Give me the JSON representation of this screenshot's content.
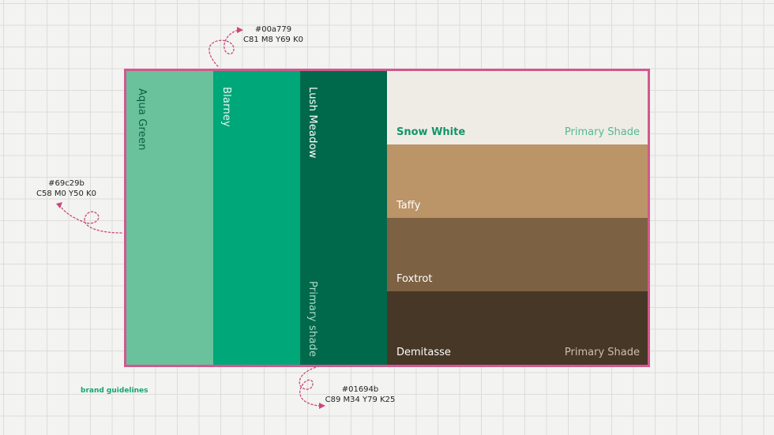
{
  "annotations": {
    "top": {
      "hex": "#00a779",
      "cmyk": "C81 M8 Y69 K0"
    },
    "left": {
      "hex": "#69c29b",
      "cmyk": "C58 M0 Y50 K0"
    },
    "bottom": {
      "hex": "#01694b",
      "cmyk": "C89 M34 Y79 K25"
    }
  },
  "vertical_swatches": [
    {
      "name": "Aqua Green",
      "color": "#69c29b"
    },
    {
      "name": "Blarney",
      "color": "#00a779"
    },
    {
      "name": "Lush Meadow",
      "color": "#01694b",
      "note": "Primary shade"
    }
  ],
  "horizontal_swatches": [
    {
      "name": "Snow White",
      "color": "#efece6",
      "note": "Primary Shade"
    },
    {
      "name": "Taffy",
      "color": "#bb9468"
    },
    {
      "name": "Foxtrot",
      "color": "#7c6143"
    },
    {
      "name": "Demitasse",
      "color": "#463726",
      "note": "Primary Shade"
    }
  ],
  "accent_color": "#d2588f",
  "footer": {
    "label": "brand guidelines"
  }
}
